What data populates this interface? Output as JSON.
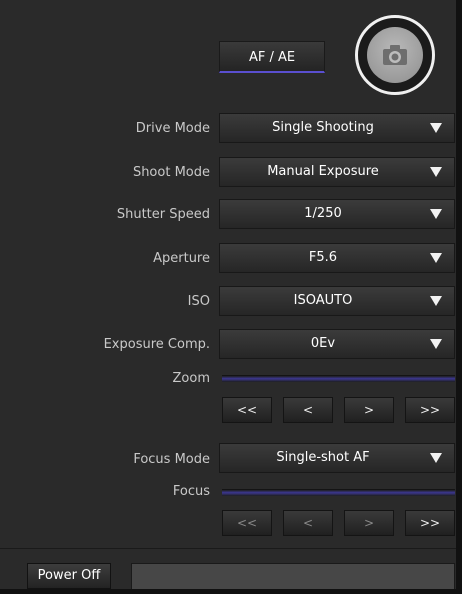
{
  "header": {
    "afae_label": "AF / AE",
    "shutter_icon": "camera-icon"
  },
  "controls": {
    "drive_mode": {
      "label": "Drive Mode",
      "value": "Single Shooting"
    },
    "shoot_mode": {
      "label": "Shoot Mode",
      "value": "Manual Exposure"
    },
    "shutter_speed": {
      "label": "Shutter Speed",
      "value": "1/250"
    },
    "aperture": {
      "label": "Aperture",
      "value": "F5.6"
    },
    "iso": {
      "label": "ISO",
      "value": "ISOAUTO"
    },
    "exposure_comp": {
      "label": "Exposure Comp.",
      "value": "0Ev"
    },
    "focus_mode": {
      "label": "Focus Mode",
      "value": "Single-shot AF"
    }
  },
  "zoom": {
    "label": "Zoom",
    "buttons": [
      "<<",
      "<",
      ">",
      ">>"
    ]
  },
  "focus": {
    "label": "Focus",
    "buttons": [
      "<<",
      "<",
      ">",
      ">>"
    ]
  },
  "footer": {
    "power_label": "Power Off",
    "status_text": ""
  },
  "colors": {
    "accent": "#5a4fd0",
    "background": "#2a2a2a"
  }
}
